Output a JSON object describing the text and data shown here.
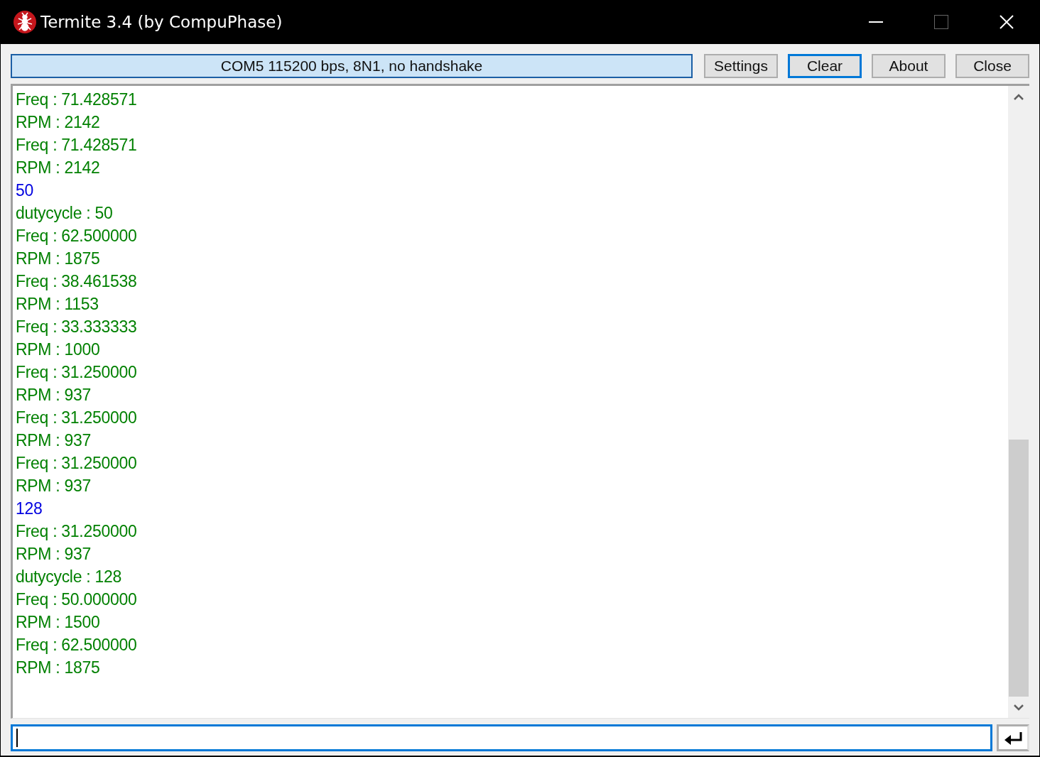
{
  "window": {
    "title": "Termite 3.4 (by CompuPhase)"
  },
  "toolbar": {
    "status": "COM5 115200 bps, 8N1, no handshake",
    "buttons": [
      {
        "label": "Settings",
        "focused": false
      },
      {
        "label": "Clear",
        "focused": true
      },
      {
        "label": "About",
        "focused": false
      },
      {
        "label": "Close",
        "focused": false
      }
    ]
  },
  "terminal": {
    "lines": [
      {
        "text": "Freq : 71.428571",
        "kind": "received"
      },
      {
        "text": "RPM : 2142",
        "kind": "received"
      },
      {
        "text": "Freq : 71.428571",
        "kind": "received"
      },
      {
        "text": "RPM : 2142",
        "kind": "received"
      },
      {
        "text": "50",
        "kind": "sent"
      },
      {
        "text": "dutycycle : 50",
        "kind": "received"
      },
      {
        "text": "Freq : 62.500000",
        "kind": "received"
      },
      {
        "text": "RPM : 1875",
        "kind": "received"
      },
      {
        "text": "Freq : 38.461538",
        "kind": "received"
      },
      {
        "text": "RPM : 1153",
        "kind": "received"
      },
      {
        "text": "Freq : 33.333333",
        "kind": "received"
      },
      {
        "text": "RPM : 1000",
        "kind": "received"
      },
      {
        "text": "Freq : 31.250000",
        "kind": "received"
      },
      {
        "text": "RPM : 937",
        "kind": "received"
      },
      {
        "text": "Freq : 31.250000",
        "kind": "received"
      },
      {
        "text": "RPM : 937",
        "kind": "received"
      },
      {
        "text": "Freq : 31.250000",
        "kind": "received"
      },
      {
        "text": "RPM : 937",
        "kind": "received"
      },
      {
        "text": "128",
        "kind": "sent"
      },
      {
        "text": "Freq : 31.250000",
        "kind": "received"
      },
      {
        "text": "RPM : 937",
        "kind": "received"
      },
      {
        "text": "dutycycle : 128",
        "kind": "received"
      },
      {
        "text": "Freq : 50.000000",
        "kind": "received"
      },
      {
        "text": "RPM : 1500",
        "kind": "received"
      },
      {
        "text": "Freq : 62.500000",
        "kind": "received"
      },
      {
        "text": "RPM : 1875",
        "kind": "received"
      }
    ]
  }
}
